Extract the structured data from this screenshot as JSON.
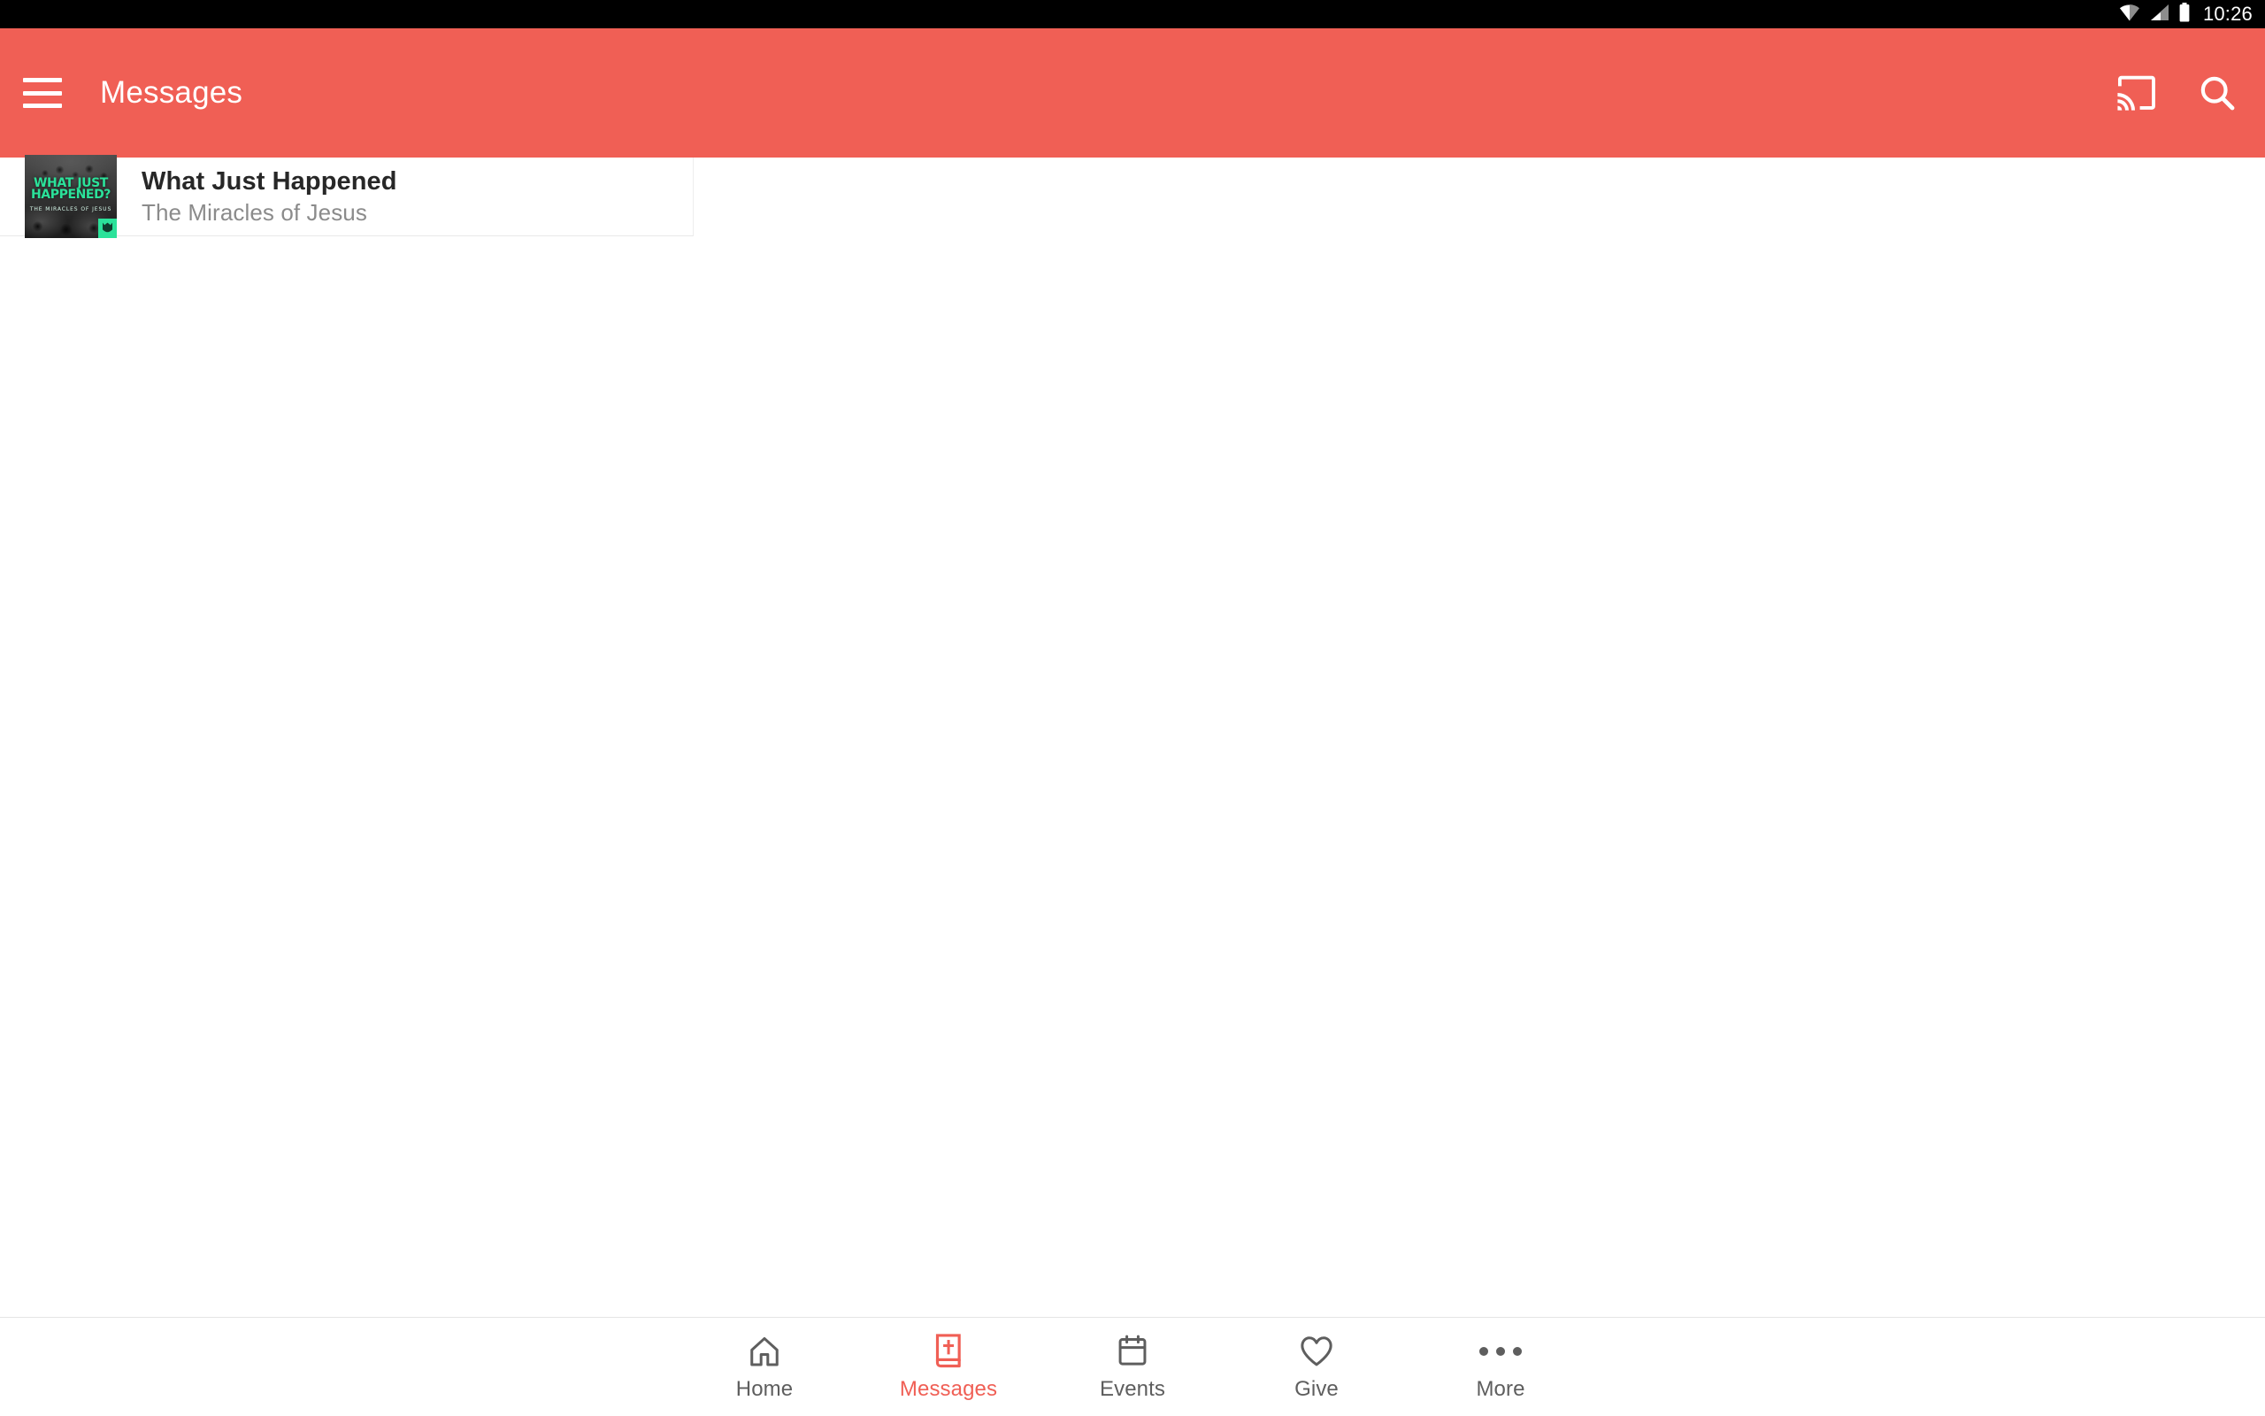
{
  "status_bar": {
    "time": "10:26",
    "icons": [
      "wifi-icon",
      "cellular-signal-icon",
      "battery-icon"
    ],
    "background": "#000000"
  },
  "app_bar": {
    "title": "Messages",
    "background": "#F05F55",
    "menu_icon": "hamburger-menu-icon",
    "actions": [
      {
        "name": "cast-icon",
        "label": "Cast"
      },
      {
        "name": "search-icon",
        "label": "Search"
      }
    ]
  },
  "main": {
    "messages": [
      {
        "title": "What Just Happened",
        "subtitle": "The Miracles of Jesus",
        "thumbnail": {
          "artwork_title": "WHAT JUST HAPPENED?",
          "artwork_subtitle": "THE MIRACLES OF JESUS",
          "accent_color": "#2BE29A",
          "badge": "church-logo-badge"
        }
      }
    ]
  },
  "bottom_nav": {
    "active_index": 1,
    "active_color": "#F05F55",
    "inactive_color": "#5E5E5E",
    "items": [
      {
        "label": "Home",
        "icon": "home-icon"
      },
      {
        "label": "Messages",
        "icon": "bible-book-icon"
      },
      {
        "label": "Events",
        "icon": "calendar-icon"
      },
      {
        "label": "Give",
        "icon": "heart-icon"
      },
      {
        "label": "More",
        "icon": "more-dots-icon"
      }
    ]
  }
}
